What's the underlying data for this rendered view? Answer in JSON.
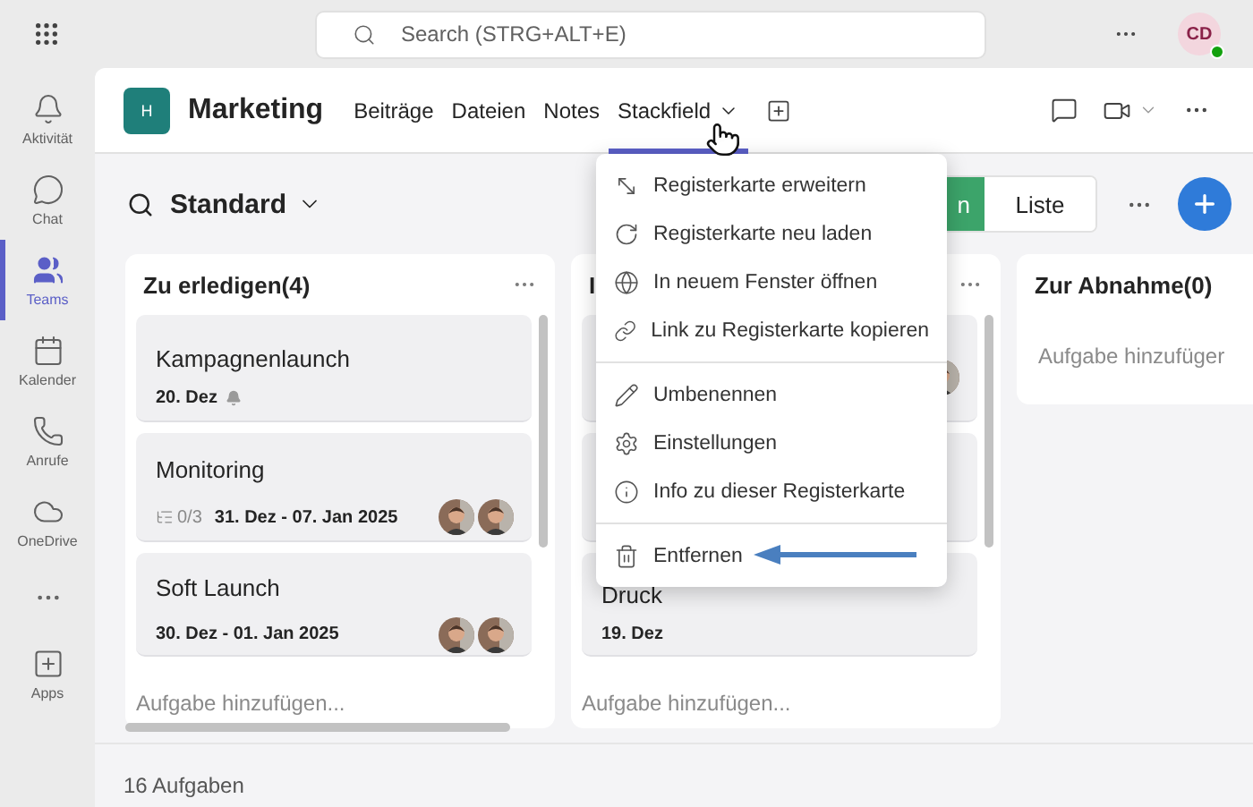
{
  "topbar": {
    "search": {
      "placeholder": "Search (STRG+ALT+E)"
    },
    "profile": {
      "initials": "CD",
      "available": true
    }
  },
  "rail": [
    {
      "kind": "app",
      "label": "Aktivität",
      "selected": false
    },
    {
      "kind": "app",
      "label": "Chat",
      "selected": false
    },
    {
      "kind": "app",
      "label": "Teams",
      "selected": true
    },
    {
      "kind": "app",
      "label": "Kalender",
      "selected": false
    },
    {
      "kind": "app",
      "label": "Anrufe",
      "selected": false
    },
    {
      "kind": "app",
      "label": "OneDrive",
      "selected": false
    },
    {
      "kind": "more"
    },
    {
      "kind": "app",
      "label": "Apps",
      "selected": false
    }
  ],
  "channel": {
    "avatar": "H",
    "name": "Marketing",
    "tabs": [
      {
        "label": "Beiträge",
        "selected": false,
        "dropdown": false
      },
      {
        "label": "Dateien",
        "selected": false,
        "dropdown": false
      },
      {
        "label": "Notes",
        "selected": false,
        "dropdown": false
      },
      {
        "label": "Stackfield",
        "selected": true,
        "dropdown": true
      }
    ]
  },
  "board": {
    "view": "Standard",
    "toggle": [
      {
        "label": "n",
        "selected": true
      },
      {
        "label": "Liste",
        "selected": false
      }
    ],
    "columns": [
      {
        "title": "Zu erledigen(4)",
        "cards": [
          {
            "kind": "task",
            "title": "Kampagnenlaunch",
            "date": "20. Dez",
            "reminder": true
          },
          {
            "kind": "task",
            "title": "Monitoring",
            "subtasks": "0/3",
            "date": "31. Dez - 07. Jan 2025"
          },
          {
            "kind": "task",
            "title": "Soft Launch",
            "date": "30. Dez - 01. Jan 2025"
          }
        ],
        "add": "Aufgabe hinzufügen..."
      },
      {
        "title": "I",
        "cards": [
          {
            "kind": "covered"
          },
          {
            "kind": "covered"
          },
          {
            "kind": "task",
            "title": "Druck",
            "date": "19. Dez"
          }
        ],
        "add": "Aufgabe hinzufügen..."
      },
      {
        "title": "Zur Abnahme(0)",
        "add": "Aufgabe hinzufüger"
      }
    ],
    "footer": "16 Aufgaben"
  },
  "menu": {
    "sections": [
      [
        {
          "label": "Registerkarte erweitern"
        },
        {
          "label": "Registerkarte neu laden"
        },
        {
          "label": "In neuem Fenster öffnen"
        },
        {
          "label": "Link zu Registerkarte kopieren"
        }
      ],
      [
        {
          "label": "Umbenennen"
        },
        {
          "label": "Einstellungen"
        },
        {
          "label": "Info zu dieser Registerkarte"
        }
      ],
      [
        {
          "label": "Entfernen",
          "pointed": true
        }
      ]
    ]
  }
}
